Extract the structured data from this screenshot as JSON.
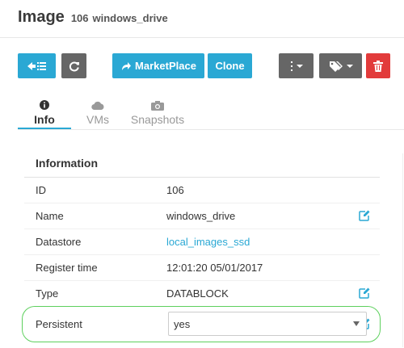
{
  "header": {
    "title": "Image",
    "id": "106",
    "name": "windows_drive"
  },
  "toolbar": {
    "back_icon": "back-list-icon",
    "refresh_icon": "refresh-icon",
    "marketplace_label": "MarketPlace",
    "clone_label": "Clone",
    "more_icon": "vertical-ellipsis-icon",
    "tags_icon": "tags-icon",
    "delete_icon": "trash-icon",
    "colors": {
      "blue": "#2aa8d4",
      "gray": "#666666",
      "red": "#e23b3b"
    }
  },
  "tabs": [
    {
      "label": "Info",
      "icon": "info-icon",
      "active": true
    },
    {
      "label": "VMs",
      "icon": "cloud-icon",
      "active": false
    },
    {
      "label": "Snapshots",
      "icon": "camera-icon",
      "active": false
    }
  ],
  "information": {
    "title": "Information",
    "rows": [
      {
        "key": "ID",
        "value": "106"
      },
      {
        "key": "Name",
        "value": "windows_drive",
        "editable": true
      },
      {
        "key": "Datastore",
        "value": "local_images_ssd",
        "link": true
      },
      {
        "key": "Register time",
        "value": "12:01:20 05/01/2017"
      },
      {
        "key": "Type",
        "value": "DATABLOCK",
        "editable": true
      },
      {
        "key": "Persistent",
        "value": "yes",
        "editable": true,
        "select": true
      }
    ]
  }
}
